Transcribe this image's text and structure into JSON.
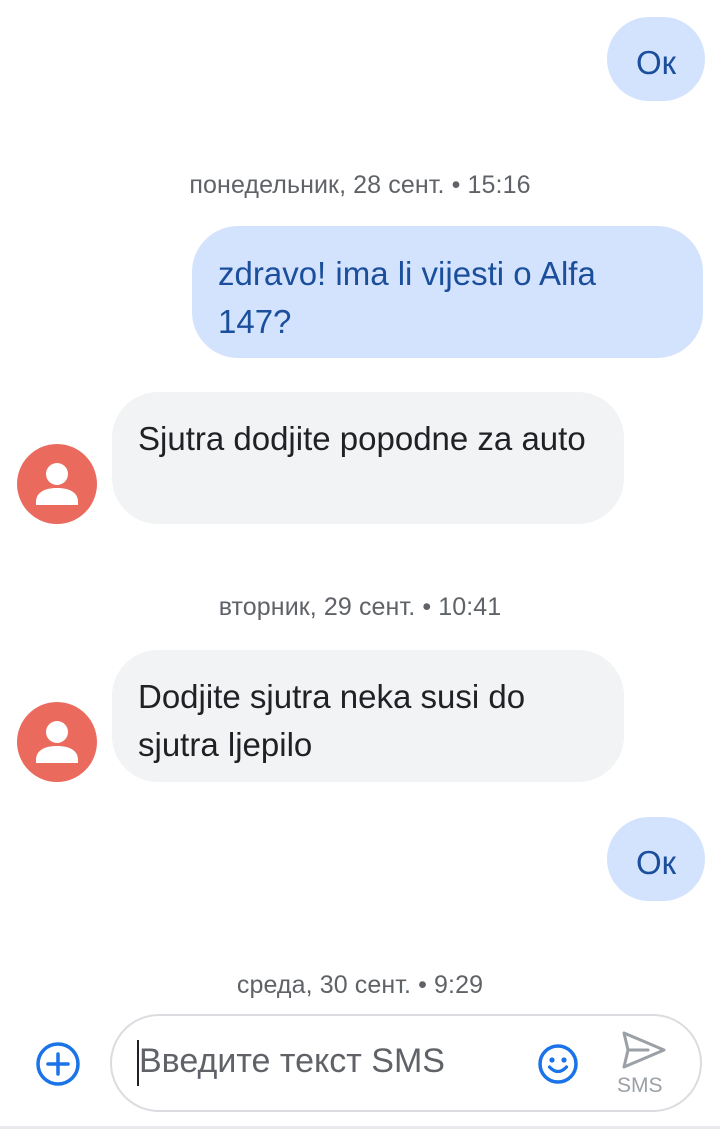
{
  "conversation": {
    "top_reply": "Ок",
    "timestamp_1": "понедельник, 28 сент. • 15:16",
    "outgoing_1": "zdravo! ima li vijesti o Alfa 147?",
    "incoming_1": "Sjutra dodjite popodne za auto",
    "timestamp_2": "вторник, 29 сент. • 10:41",
    "incoming_2": "Dodjite sjutra neka susi do sjutra ljepilo",
    "reply_2": "Ок",
    "timestamp_3": "среда, 30 сент. • 9:29"
  },
  "composer": {
    "placeholder": "Введите текст SMS",
    "send_label": "SMS",
    "icons": [
      "add-attachment-icon",
      "emoji-icon",
      "send-icon"
    ]
  },
  "colors": {
    "outgoing_bubble": "#d3e3fd",
    "outgoing_text": "#1b4f9c",
    "incoming_bubble": "#f1f3f4",
    "avatar": "#ea6a5e",
    "accent": "#1a73e8"
  }
}
